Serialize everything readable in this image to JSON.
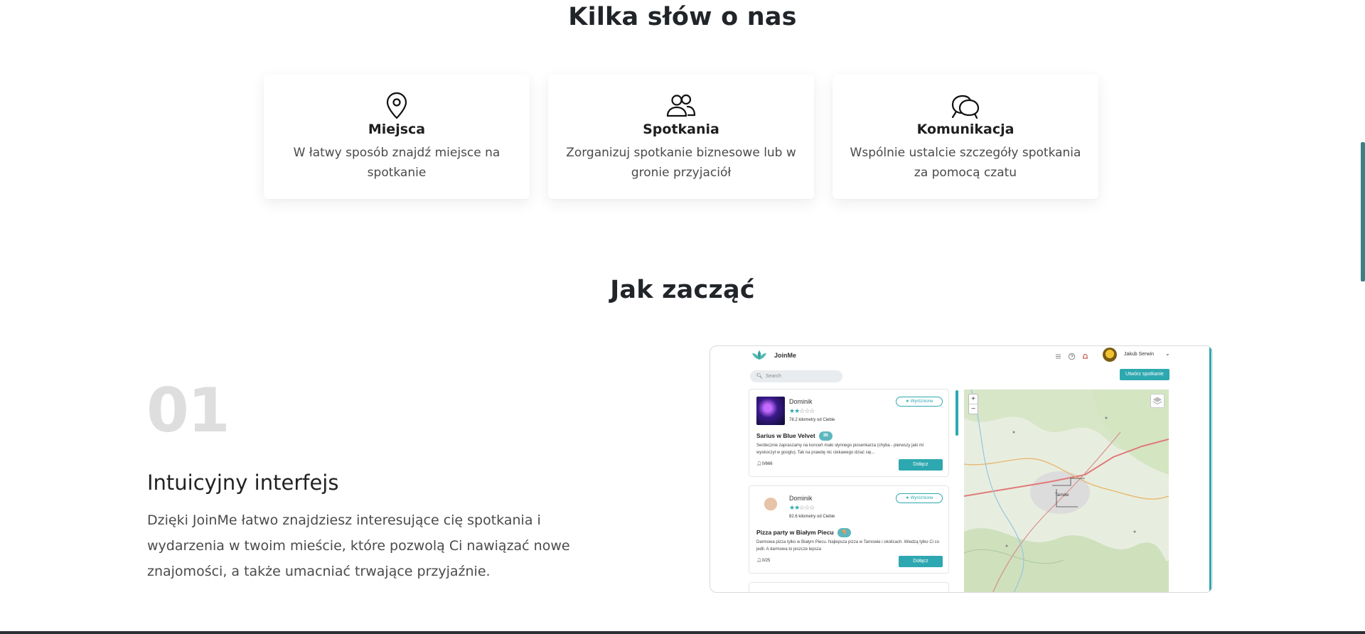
{
  "about": {
    "title": "Kilka słów o nas",
    "cards": [
      {
        "icon": "map-pin-icon",
        "title": "Miejsca",
        "text": "W łatwy sposób znajdź miejsce na spotkanie"
      },
      {
        "icon": "people-icon",
        "title": "Spotkania",
        "text": "Zorganizuj spotkanie biznesowe lub w gronie przyjaciół"
      },
      {
        "icon": "chat-bubbles-icon",
        "title": "Komunikacja",
        "text": "Wspólnie ustalcie szczegóły spotkania za pomocą czatu"
      }
    ]
  },
  "start": {
    "title": "Jak zacząć",
    "step_number": "01",
    "step_title": "Intuicyjny interfejs",
    "step_text": "Dzięki JoinMe łatwo znajdziesz interesujące cię spotkania i wydarzenia w twoim mieście, które pozwolą Ci nawiązać nowe znajomości, a także umacniać trwające przyjaźnie."
  },
  "mockup": {
    "brand": "JoinMe",
    "user_name": "Jakub Serwin",
    "search_placeholder": "Search",
    "create_button": "Utwórz spotkanie",
    "events": [
      {
        "organizer": "Dominik",
        "rating": 2,
        "max_rating": 5,
        "distance": "78.2 kilometry od Ciebie",
        "featured": "Wyróżnione",
        "title": "Sarius w Blue Velvet",
        "tag": "3K",
        "description": "Serdecznie zapraszamy na koncert mało słynnego piosenkarza (chyba - pierwszy jaki mi wyskoczył w googlu). Tak na prawdę nic ciekawego dziać się...",
        "participants": "0/666",
        "join_button": "Dołącz"
      },
      {
        "organizer": "Dominik",
        "rating": 2,
        "max_rating": 5,
        "distance": "82.6 kilometry od Ciebie",
        "featured": "Wyróżnione",
        "title": "Pizza party w Białym Piecu",
        "tag": "🍕",
        "description": "Darmowa pizza tylko w Białym Piecu. Najlepsza pizza w Tarnowie i okolicach. Wiedzą tylko Ci co jedli. A darmowa to jeszcze lepsza",
        "participants": "0/25",
        "join_button": "Dołącz"
      }
    ],
    "map": {
      "city_label": "Tarnów",
      "zoom_in": "+",
      "zoom_out": "−"
    }
  },
  "colors": {
    "accent": "#2ea8b0",
    "heading": "#212529",
    "step_number": "#dedede"
  }
}
